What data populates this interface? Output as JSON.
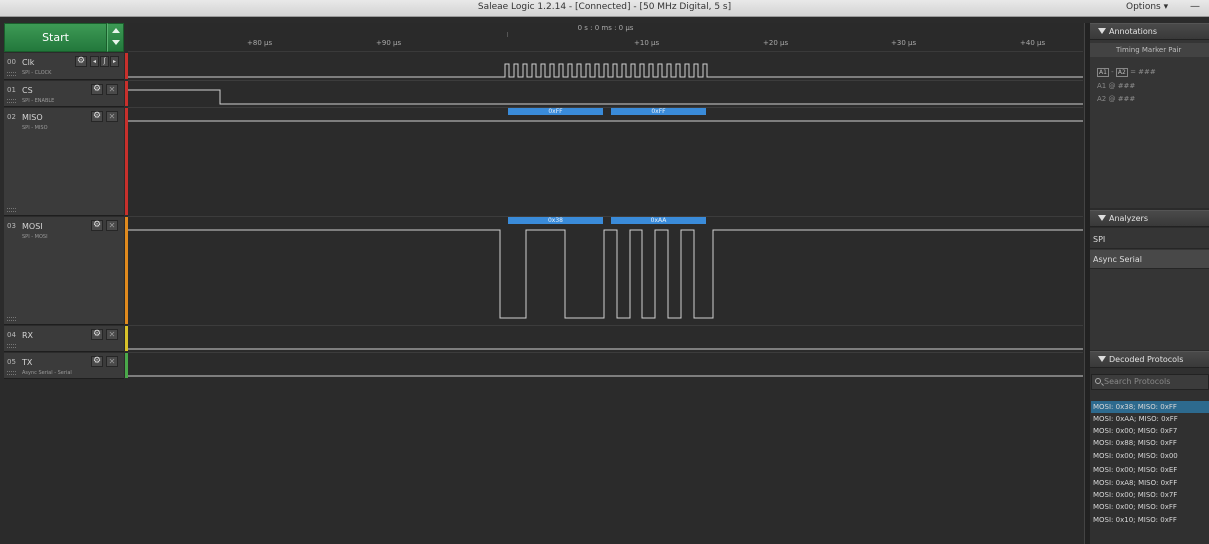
{
  "window": {
    "title": "Saleae Logic 1.2.14 - [Connected] - [50 MHz Digital, 5 s]",
    "options_label": "Options ▾",
    "minimize_label": "—"
  },
  "start": {
    "label": "Start"
  },
  "ruler": {
    "zero_label": "0 s : 0 ms : 0 µs",
    "ticks": [
      "+80 µs",
      "+90 µs",
      "+10 µs",
      "+20 µs",
      "+30 µs",
      "+40 µs"
    ]
  },
  "channels": [
    {
      "num": "00",
      "name": "Clk",
      "sub": "SPI - CLOCK"
    },
    {
      "num": "01",
      "name": "CS",
      "sub": "SPI - ENABLE"
    },
    {
      "num": "02",
      "name": "MISO",
      "sub": "SPI - MISO"
    },
    {
      "num": "03",
      "name": "MOSI",
      "sub": "SPI - MOSI"
    },
    {
      "num": "04",
      "name": "RX",
      "sub": ""
    },
    {
      "num": "05",
      "name": "TX",
      "sub": "Async Serial - Serial"
    }
  ],
  "bubbles": {
    "miso": [
      "0xFF",
      "0xFF"
    ],
    "mosi": [
      "0x38",
      "0xAA"
    ]
  },
  "colors": {
    "accent_green": "#2e8a47",
    "bubble_blue": "#3a8bd9",
    "selected_row": "#2d6a8e",
    "stripe_red": "#c8302c",
    "stripe_orange": "#e08a1e",
    "stripe_yellow": "#d8c22a",
    "stripe_green": "#4aa84a"
  },
  "annotations": {
    "header": "Annotations",
    "pair_label": "Timing Marker Pair",
    "formula_a1": "A1",
    "formula_minus": "-",
    "formula_a2": "A2",
    "formula_eq": "= ###",
    "a1_row": "A1  @  ###",
    "a2_row": "A2  @  ###"
  },
  "analyzers": {
    "header": "Analyzers",
    "items": [
      "SPI",
      "Async Serial"
    ]
  },
  "decoded": {
    "header": "Decoded Protocols",
    "search_placeholder": "Search Protocols",
    "rows": [
      "MOSI: 0x38;  MISO: 0xFF",
      "MOSI: 0xAA;  MISO: 0xFF",
      "MOSI: 0x00;  MISO: 0xF7",
      "MOSI: 0x88;  MISO: 0xFF",
      "MOSI: 0x00;  MISO: 0x00",
      "MOSI: 0x00;  MISO: 0xEF",
      "MOSI: 0xA8;  MISO: 0xFF",
      "MOSI: 0x00;  MISO: 0x7F",
      "MOSI: 0x00;  MISO: 0xFF",
      "MOSI: 0x10;  MISO: 0xFF"
    ]
  }
}
